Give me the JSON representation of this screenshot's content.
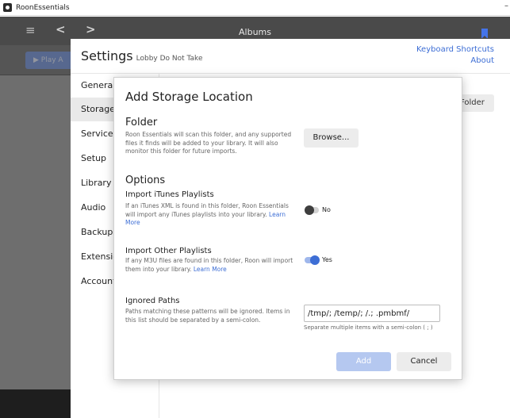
{
  "window": {
    "title": "RoonEssentials",
    "minimize_glyph": "–"
  },
  "app": {
    "topbar": {
      "title": "Albums",
      "hamburger_glyph": "≡",
      "back_glyph": "<",
      "forward_glyph": ">"
    },
    "play_label": "▶ Play A"
  },
  "settings": {
    "title": "Settings",
    "subtitle": "Lobby Do Not Take",
    "keyboard_shortcuts": "Keyboard Shortcuts",
    "about": "About",
    "folder_button": "Folder",
    "nav": [
      {
        "label": "General"
      },
      {
        "label": "Storage"
      },
      {
        "label": "Services"
      },
      {
        "label": "Setup"
      },
      {
        "label": "Library"
      },
      {
        "label": "Audio"
      },
      {
        "label": "Backups"
      },
      {
        "label": "Extensions"
      },
      {
        "label": "Account"
      }
    ],
    "active_nav": "Storage"
  },
  "modal": {
    "title": "Add Storage Location",
    "folder": {
      "title": "Folder",
      "description": "Roon Essentials will scan this folder, and any supported files it finds will be added to your library. It will also monitor this folder for future imports.",
      "browse_label": "Browse..."
    },
    "options": {
      "title": "Options",
      "itunes": {
        "title": "Import iTunes Playlists",
        "description": "If an iTunes XML is found in this folder, Roon Essentials will import any iTunes playlists into your library.",
        "learn_more": "Learn More",
        "toggle_label": "No",
        "enabled": false
      },
      "other": {
        "title": "Import Other Playlists",
        "description": "If any M3U files are found in this folder, Roon will import them into your library.",
        "learn_more": "Learn More",
        "toggle_label": "Yes",
        "enabled": true
      }
    },
    "ignored": {
      "title": "Ignored Paths",
      "description": "Paths matching these patterns will be ignored. Items in this list should be separated by a semi-colon.",
      "value": "/tmp/; /temp/; /.; .pmbmf/",
      "hint": "Separate multiple items with a semi-colon ( ; )"
    },
    "add_label": "Add",
    "cancel_label": "Cancel"
  },
  "colors": {
    "accent": "#3d6ed5",
    "disabled_accent": "#b5c8f0",
    "app_bg": "#6e6e6e"
  }
}
